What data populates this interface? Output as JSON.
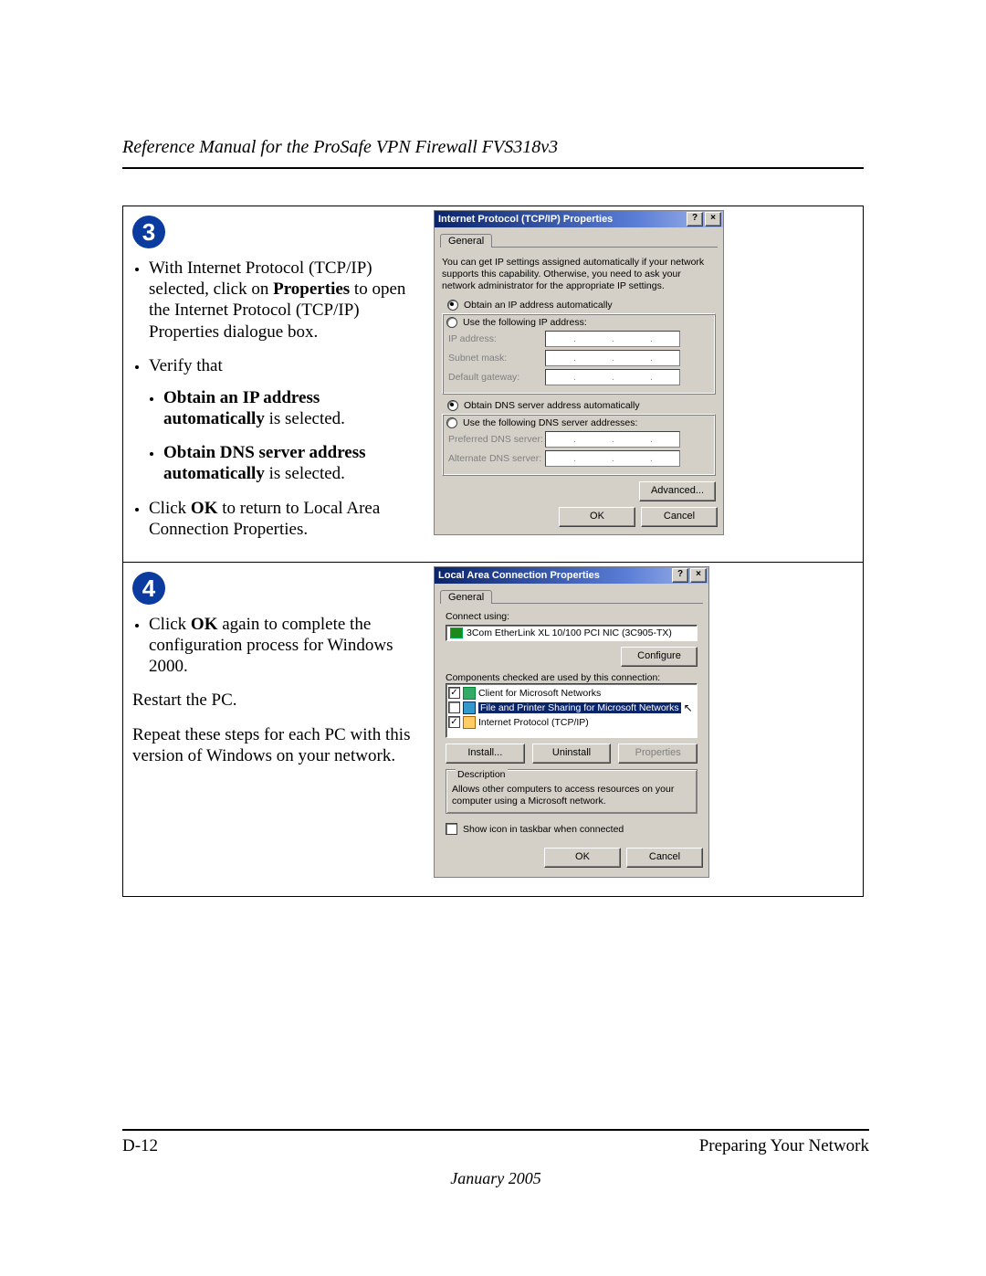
{
  "header": {
    "title": "Reference Manual for the ProSafe VPN Firewall FVS318v3"
  },
  "step3": {
    "number": "3",
    "bullet1_a": "With Internet Protocol (TCP/IP) selected, click on ",
    "bullet1_b": "Properties",
    "bullet1_c": " to open the Internet Protocol (TCP/IP) Properties dialogue box.",
    "bullet2": "Verify that",
    "sub_a_bold": "Obtain an IP address automatically",
    "sub_a_rest": " is selected.",
    "sub_b_bold": "Obtain DNS server address automatically",
    "sub_b_rest": " is selected.",
    "bullet3_a": "Click ",
    "bullet3_b": "OK",
    "bullet3_c": " to return to Local Area Connection Properties."
  },
  "step4": {
    "number": "4",
    "bullet1_a": "Click ",
    "bullet1_b": "OK",
    "bullet1_c": " again to complete the configuration process for Windows 2000.",
    "para1": "Restart the PC.",
    "para2": "Repeat these steps for each PC with this version of Windows on your network."
  },
  "dlg1": {
    "title": "Internet Protocol (TCP/IP) Properties",
    "tab": "General",
    "desc": "You can get IP settings assigned automatically if your network supports this capability. Otherwise, you need to ask your network administrator for the appropriate IP settings.",
    "r1": "Obtain an IP address automatically",
    "r2": "Use the following IP address:",
    "f_ip": "IP address:",
    "f_mask": "Subnet mask:",
    "f_gw": "Default gateway:",
    "r3": "Obtain DNS server address automatically",
    "r4": "Use the following DNS server addresses:",
    "f_pdns": "Preferred DNS server:",
    "f_adns": "Alternate DNS server:",
    "advanced": "Advanced...",
    "ok": "OK",
    "cancel": "Cancel"
  },
  "dlg2": {
    "title": "Local Area Connection Properties",
    "tab": "General",
    "connect_using": "Connect using:",
    "nic": "3Com EtherLink XL 10/100 PCI NIC (3C905-TX)",
    "configure": "Configure",
    "components_label": "Components checked are used by this connection:",
    "c1": "Client for Microsoft Networks",
    "c2": "File and Printer Sharing for Microsoft Networks",
    "c3": "Internet Protocol (TCP/IP)",
    "install": "Install...",
    "uninstall": "Uninstall",
    "properties": "Properties",
    "desc_label": "Description",
    "desc_text": "Allows other computers to access resources on your computer using a Microsoft network.",
    "show_icon": "Show icon in taskbar when connected",
    "ok": "OK",
    "cancel": "Cancel"
  },
  "footer": {
    "left": "D-12",
    "right": "Preparing Your Network",
    "date": "January 2005"
  }
}
